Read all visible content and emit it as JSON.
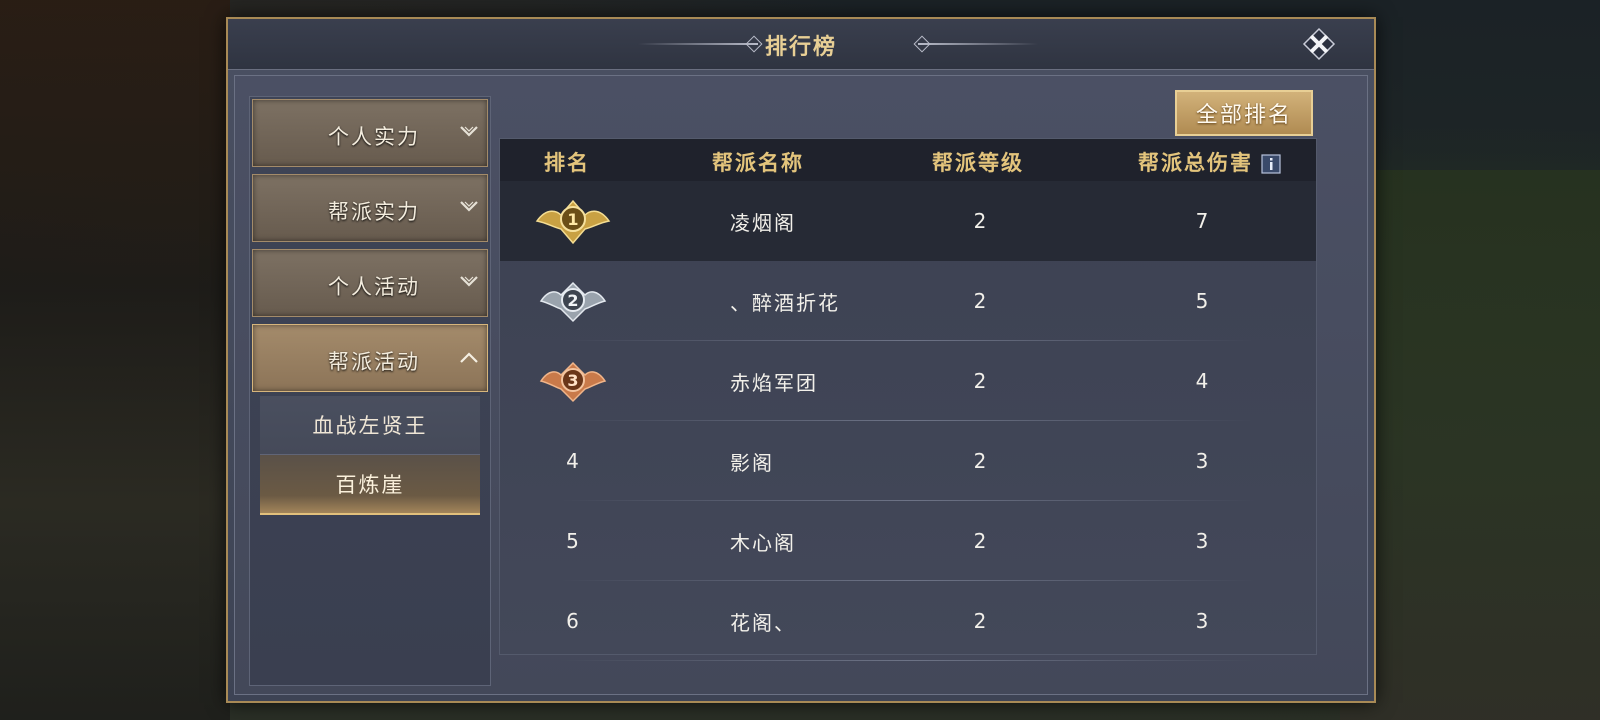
{
  "title": "排行榜",
  "colors": {
    "gold": "#e3c47c",
    "accent": "#d2b27a",
    "frame": "#a88a56"
  },
  "sidebar": {
    "items": [
      {
        "label": "个人实力",
        "icon": "chevron-down-icon"
      },
      {
        "label": "帮派实力",
        "icon": "chevron-down-icon"
      },
      {
        "label": "个人活动",
        "icon": "chevron-down-icon"
      },
      {
        "label": "帮派活动",
        "icon": "chevron-up-icon",
        "expanded": true
      }
    ],
    "subitems": [
      {
        "label": "血战左贤王"
      },
      {
        "label": "百炼崖",
        "selected": true
      }
    ]
  },
  "all_rank_button": "全部排名",
  "table": {
    "headers": {
      "rank": "排名",
      "name": "帮派名称",
      "level": "帮派等级",
      "damage": "帮派总伤害"
    },
    "rows": [
      {
        "rank": "1",
        "medal": "gold-medal-icon",
        "name": "凌烟阁",
        "level": "2",
        "damage": "7"
      },
      {
        "rank": "2",
        "medal": "silver-medal-icon",
        "name": "、醉酒折花",
        "level": "2",
        "damage": "5"
      },
      {
        "rank": "3",
        "medal": "bronze-medal-icon",
        "name": "赤焰军团",
        "level": "2",
        "damage": "4"
      },
      {
        "rank": "4",
        "name": "影阁",
        "level": "2",
        "damage": "3"
      },
      {
        "rank": "5",
        "name": "木心阁",
        "level": "2",
        "damage": "3"
      },
      {
        "rank": "6",
        "name": "花阁、",
        "level": "2",
        "damage": "3"
      }
    ]
  }
}
